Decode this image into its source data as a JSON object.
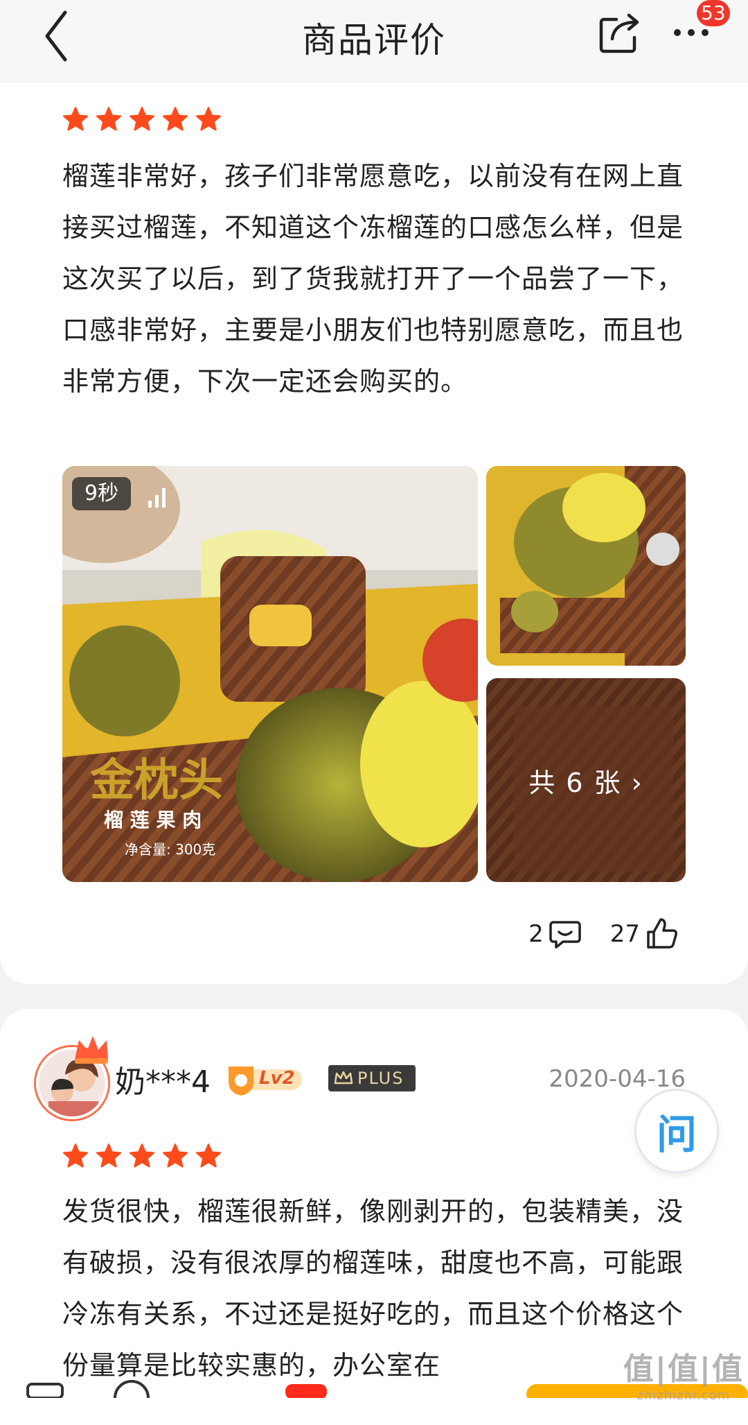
{
  "header": {
    "title": "商品评价",
    "notification_count": "53"
  },
  "colors": {
    "star": "#ff4a1c",
    "badge": "#f0352b",
    "ask_icon": "#2f9be6"
  },
  "reviews": [
    {
      "rating": 5,
      "text": "榴莲非常好，孩子们非常愿意吃，以前没有在网上直接买过榴莲，不知道这个冻榴莲的口感怎么样，但是这次买了以后，到了货我就打开了一个品尝了一下，口感非常好，主要是小朋友们也特别愿意吃，而且也非常方便，下次一定还会购买的。",
      "media": {
        "video_duration": "9秒",
        "more_images_label": "共 6 张 ›"
      },
      "comment_count": "2",
      "like_count": "27"
    },
    {
      "username": "奶***4",
      "level": "Lv2",
      "plus_label": "PLUS",
      "date": "2020-04-16",
      "rating": 5,
      "text": "发货很快，榴莲很新鲜，像刚剥开的，包装精美，没有破损，没有很浓厚的榴莲味，甜度也不高，可能跟冷冻有关系，不过还是挺好吃的，而且这个价格这个份量算是比较实惠的，办公室在"
    }
  ],
  "floating": {
    "ask_label": "问"
  },
  "watermark": {
    "text": "值|值|值",
    "sub": "zhizhizhi.com"
  }
}
